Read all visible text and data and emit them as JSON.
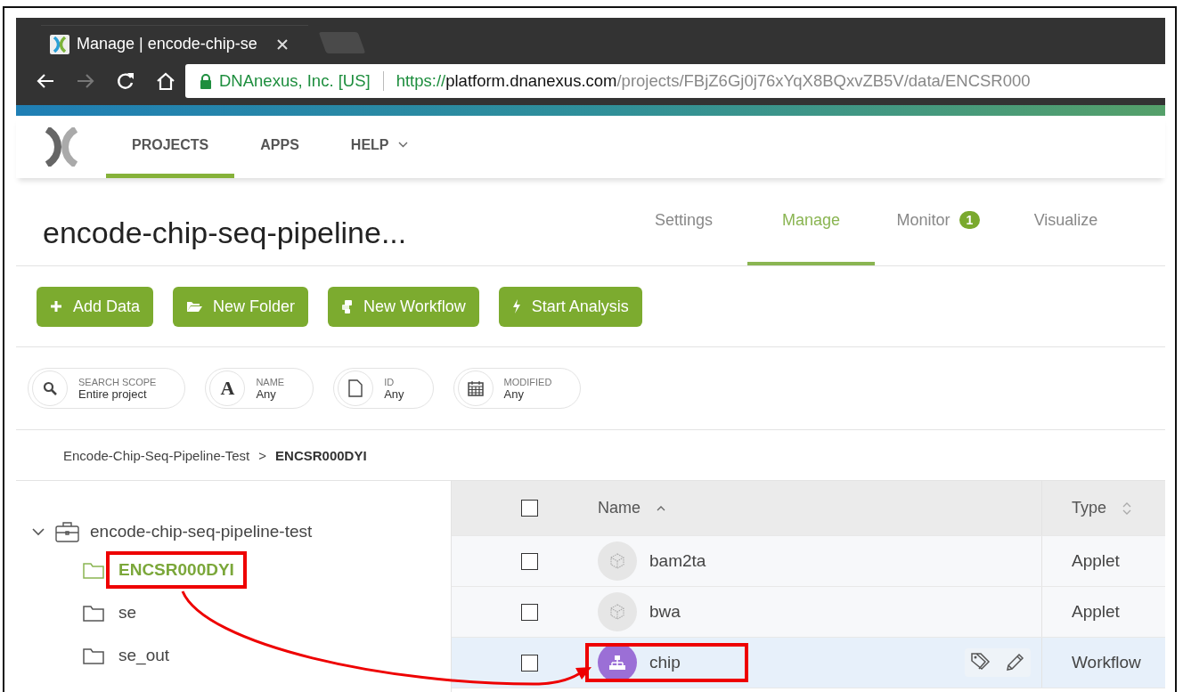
{
  "browser": {
    "tab": {
      "title": "Manage | encode-chip-se"
    },
    "address": {
      "site": "DNAnexus, Inc. [US]",
      "scheme": "https://",
      "host": "platform.dnanexus.com",
      "path": "/projects/FBjZ6Gj0j76xYqX8BQxvZB5V/data/ENCSR000"
    }
  },
  "nav": {
    "items": [
      {
        "label": "PROJECTS",
        "selected": true,
        "dropdown": false
      },
      {
        "label": "APPS",
        "selected": false,
        "dropdown": false
      },
      {
        "label": "HELP",
        "selected": false,
        "dropdown": true
      }
    ]
  },
  "project": {
    "title": "encode-chip-seq-pipeline...",
    "tabs": [
      {
        "label": "Settings",
        "selected": false
      },
      {
        "label": "Manage",
        "selected": true
      },
      {
        "label": "Monitor",
        "selected": false,
        "badge": "1"
      },
      {
        "label": "Visualize",
        "selected": false
      }
    ]
  },
  "actions": [
    {
      "kind": "plus",
      "label": "Add Data"
    },
    {
      "kind": "folder",
      "label": "New Folder"
    },
    {
      "kind": "workflow",
      "label": "New Workflow"
    },
    {
      "kind": "bolt",
      "label": "Start Analysis"
    }
  ],
  "filters": [
    {
      "kind": "search",
      "label": "SEARCH SCOPE",
      "value": "Entire project"
    },
    {
      "kind": "name",
      "label": "NAME",
      "value": "Any",
      "icon": "A"
    },
    {
      "kind": "id",
      "label": "ID",
      "value": "Any"
    },
    {
      "kind": "date",
      "label": "MODIFIED",
      "value": "Any"
    }
  ],
  "breadcrumb": [
    {
      "label": "Encode-Chip-Seq-Pipeline-Test",
      "current": false
    },
    {
      "separator": ">",
      "label": "ENCSR000DYI",
      "current": true
    }
  ],
  "tree": [
    {
      "label": "encode-chip-seq-pipeline-test",
      "expanded": true,
      "children": [
        {
          "label": "ENCSR000DYI",
          "selected": true,
          "highlighted": true
        },
        {
          "label": "se",
          "selected": false,
          "highlighted": false
        },
        {
          "label": "se_out",
          "selected": false,
          "highlighted": false
        }
      ]
    }
  ],
  "table": {
    "all_checked": false,
    "columns": [
      {
        "label": "Name",
        "sorted": true
      },
      {
        "label": "Type",
        "sorted": false
      }
    ],
    "rows": [
      {
        "kind": "applet",
        "name": "bam2ta",
        "type": "Applet",
        "checked": false,
        "selected": false,
        "highlighted": false
      },
      {
        "kind": "applet",
        "name": "bwa",
        "type": "Applet",
        "checked": false,
        "selected": false,
        "highlighted": false
      },
      {
        "kind": "workflow",
        "name": "chip",
        "type": "Workflow",
        "checked": false,
        "selected": true,
        "highlighted": true
      }
    ]
  }
}
